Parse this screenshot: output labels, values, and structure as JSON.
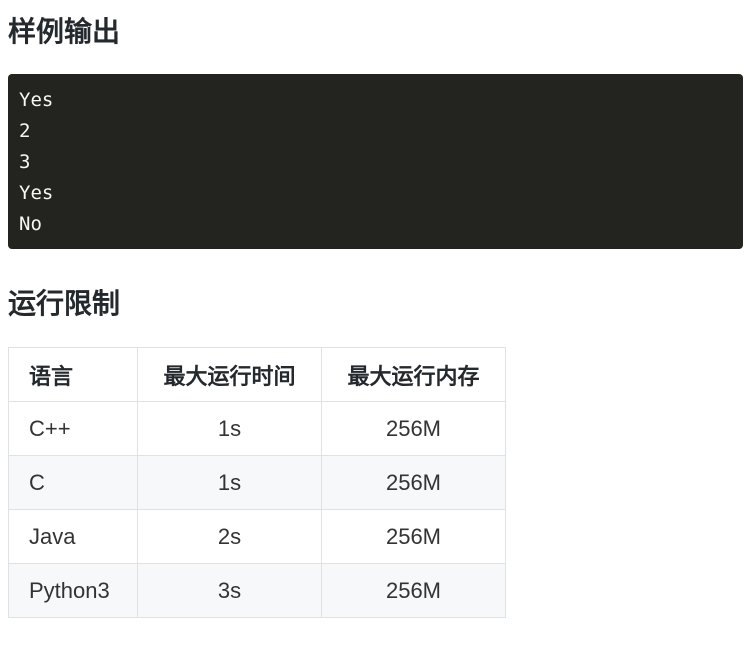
{
  "sample_output": {
    "heading": "样例输出",
    "lines": [
      "Yes",
      "2",
      "3",
      "Yes",
      "No"
    ]
  },
  "limits": {
    "heading": "运行限制",
    "headers": [
      "语言",
      "最大运行时间",
      "最大运行内存"
    ],
    "rows": [
      [
        "C++",
        "1s",
        "256M"
      ],
      [
        "C",
        "1s",
        "256M"
      ],
      [
        "Java",
        "2s",
        "256M"
      ],
      [
        "Python3",
        "3s",
        "256M"
      ]
    ]
  },
  "colors": {
    "code_background": "#23241f",
    "code_text": "#f8f8f2",
    "table_border": "#dfe2e5",
    "row_alt_background": "#f6f8fa"
  }
}
